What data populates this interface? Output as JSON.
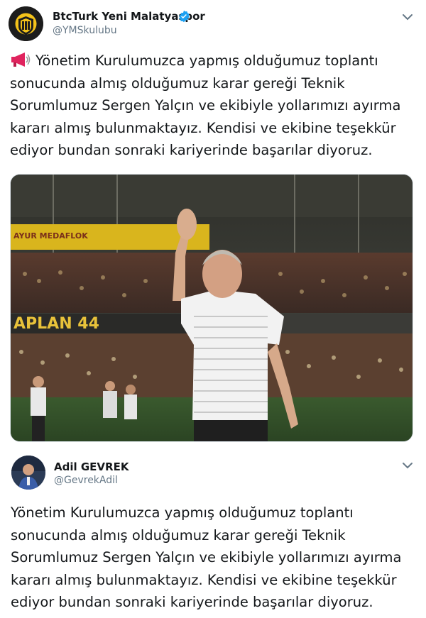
{
  "tweet1": {
    "author_name": "BtcTurk Yeni Malatyaspor",
    "author_handle": "@YMSkulubu",
    "verified": true,
    "text": "Yönetim Kurulumuzca yapmış olduğumuz toplantı\nsonucunda almış olduğumuz karar gereği Teknik\nSorumlumuz Sergen Yalçın ve ekibiyle yollarımızı ayırma\nkararı almış bulunmaktayız. Kendisi ve ekibine teşekkür\nediyor bundan sonraki kariyerinde başarılar diyoruz.",
    "megaphone_icon": "megaphone-icon",
    "photo": {
      "banner_text": "AYUR MEDAFLOK",
      "stand_text": "APLAN 44"
    }
  },
  "tweet2": {
    "author_name": "Adil GEVREK",
    "author_handle": "@GevrekAdil",
    "text": "Yönetim Kurulumuzca yapmış olduğumuz toplantı\nsonucunda almış olduğumuz karar gereği Teknik\nSorumlumuz Sergen Yalçın ve ekibiyle yollarımızı ayırma\nkararı almış bulunmaktayız. Kendisi ve ekibine teşekkür\nediyor bundan sonraki kariyerinde başarılar diyoruz."
  },
  "colors": {
    "verified": "#1da1f2",
    "handle": "#657786",
    "text": "#14171a",
    "megaphone": "#e0245e"
  }
}
